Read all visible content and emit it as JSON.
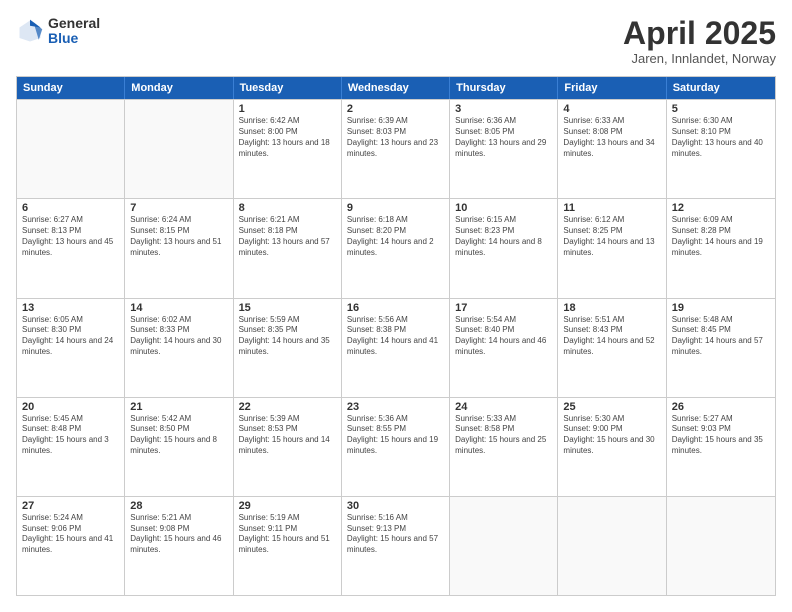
{
  "logo": {
    "general": "General",
    "blue": "Blue"
  },
  "title": "April 2025",
  "subtitle": "Jaren, Innlandet, Norway",
  "days_of_week": [
    "Sunday",
    "Monday",
    "Tuesday",
    "Wednesday",
    "Thursday",
    "Friday",
    "Saturday"
  ],
  "weeks": [
    [
      {
        "day": "",
        "info": ""
      },
      {
        "day": "",
        "info": ""
      },
      {
        "day": "1",
        "info": "Sunrise: 6:42 AM\nSunset: 8:00 PM\nDaylight: 13 hours and 18 minutes."
      },
      {
        "day": "2",
        "info": "Sunrise: 6:39 AM\nSunset: 8:03 PM\nDaylight: 13 hours and 23 minutes."
      },
      {
        "day": "3",
        "info": "Sunrise: 6:36 AM\nSunset: 8:05 PM\nDaylight: 13 hours and 29 minutes."
      },
      {
        "day": "4",
        "info": "Sunrise: 6:33 AM\nSunset: 8:08 PM\nDaylight: 13 hours and 34 minutes."
      },
      {
        "day": "5",
        "info": "Sunrise: 6:30 AM\nSunset: 8:10 PM\nDaylight: 13 hours and 40 minutes."
      }
    ],
    [
      {
        "day": "6",
        "info": "Sunrise: 6:27 AM\nSunset: 8:13 PM\nDaylight: 13 hours and 45 minutes."
      },
      {
        "day": "7",
        "info": "Sunrise: 6:24 AM\nSunset: 8:15 PM\nDaylight: 13 hours and 51 minutes."
      },
      {
        "day": "8",
        "info": "Sunrise: 6:21 AM\nSunset: 8:18 PM\nDaylight: 13 hours and 57 minutes."
      },
      {
        "day": "9",
        "info": "Sunrise: 6:18 AM\nSunset: 8:20 PM\nDaylight: 14 hours and 2 minutes."
      },
      {
        "day": "10",
        "info": "Sunrise: 6:15 AM\nSunset: 8:23 PM\nDaylight: 14 hours and 8 minutes."
      },
      {
        "day": "11",
        "info": "Sunrise: 6:12 AM\nSunset: 8:25 PM\nDaylight: 14 hours and 13 minutes."
      },
      {
        "day": "12",
        "info": "Sunrise: 6:09 AM\nSunset: 8:28 PM\nDaylight: 14 hours and 19 minutes."
      }
    ],
    [
      {
        "day": "13",
        "info": "Sunrise: 6:05 AM\nSunset: 8:30 PM\nDaylight: 14 hours and 24 minutes."
      },
      {
        "day": "14",
        "info": "Sunrise: 6:02 AM\nSunset: 8:33 PM\nDaylight: 14 hours and 30 minutes."
      },
      {
        "day": "15",
        "info": "Sunrise: 5:59 AM\nSunset: 8:35 PM\nDaylight: 14 hours and 35 minutes."
      },
      {
        "day": "16",
        "info": "Sunrise: 5:56 AM\nSunset: 8:38 PM\nDaylight: 14 hours and 41 minutes."
      },
      {
        "day": "17",
        "info": "Sunrise: 5:54 AM\nSunset: 8:40 PM\nDaylight: 14 hours and 46 minutes."
      },
      {
        "day": "18",
        "info": "Sunrise: 5:51 AM\nSunset: 8:43 PM\nDaylight: 14 hours and 52 minutes."
      },
      {
        "day": "19",
        "info": "Sunrise: 5:48 AM\nSunset: 8:45 PM\nDaylight: 14 hours and 57 minutes."
      }
    ],
    [
      {
        "day": "20",
        "info": "Sunrise: 5:45 AM\nSunset: 8:48 PM\nDaylight: 15 hours and 3 minutes."
      },
      {
        "day": "21",
        "info": "Sunrise: 5:42 AM\nSunset: 8:50 PM\nDaylight: 15 hours and 8 minutes."
      },
      {
        "day": "22",
        "info": "Sunrise: 5:39 AM\nSunset: 8:53 PM\nDaylight: 15 hours and 14 minutes."
      },
      {
        "day": "23",
        "info": "Sunrise: 5:36 AM\nSunset: 8:55 PM\nDaylight: 15 hours and 19 minutes."
      },
      {
        "day": "24",
        "info": "Sunrise: 5:33 AM\nSunset: 8:58 PM\nDaylight: 15 hours and 25 minutes."
      },
      {
        "day": "25",
        "info": "Sunrise: 5:30 AM\nSunset: 9:00 PM\nDaylight: 15 hours and 30 minutes."
      },
      {
        "day": "26",
        "info": "Sunrise: 5:27 AM\nSunset: 9:03 PM\nDaylight: 15 hours and 35 minutes."
      }
    ],
    [
      {
        "day": "27",
        "info": "Sunrise: 5:24 AM\nSunset: 9:06 PM\nDaylight: 15 hours and 41 minutes."
      },
      {
        "day": "28",
        "info": "Sunrise: 5:21 AM\nSunset: 9:08 PM\nDaylight: 15 hours and 46 minutes."
      },
      {
        "day": "29",
        "info": "Sunrise: 5:19 AM\nSunset: 9:11 PM\nDaylight: 15 hours and 51 minutes."
      },
      {
        "day": "30",
        "info": "Sunrise: 5:16 AM\nSunset: 9:13 PM\nDaylight: 15 hours and 57 minutes."
      },
      {
        "day": "",
        "info": ""
      },
      {
        "day": "",
        "info": ""
      },
      {
        "day": "",
        "info": ""
      }
    ]
  ]
}
